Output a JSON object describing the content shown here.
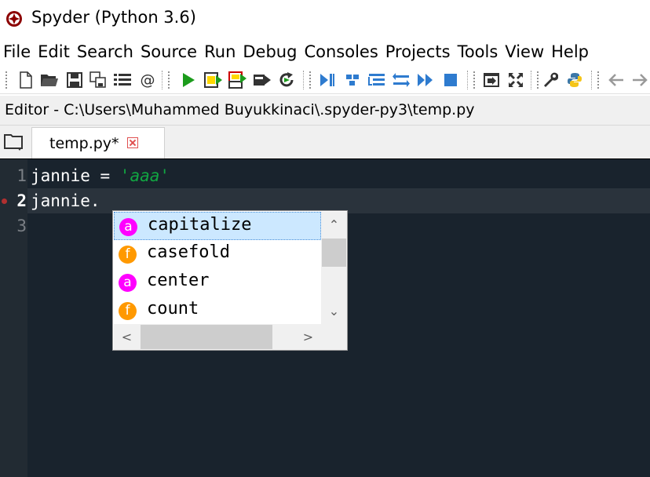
{
  "window": {
    "title": "Spyder (Python 3.6)"
  },
  "menu": [
    "File",
    "Edit",
    "Search",
    "Source",
    "Run",
    "Debug",
    "Consoles",
    "Projects",
    "Tools",
    "View",
    "Help"
  ],
  "toolbar": {
    "file_icons": [
      "new-file-icon",
      "open-file-icon",
      "save-icon",
      "save-all-icon",
      "outline-icon",
      "at-icon"
    ],
    "run_icons": [
      "run-icon",
      "run-cell-icon",
      "run-cell-advance-icon",
      "run-selection-icon",
      "rerun-icon"
    ],
    "debug_icons": [
      "debug-icon",
      "debug-step-icon",
      "debug-step-into-icon",
      "debug-step-return-icon",
      "debug-continue-icon",
      "debug-stop-icon"
    ],
    "window_icons": [
      "maximize-pane-icon",
      "fullscreen-icon"
    ],
    "tool_icons": [
      "preferences-wrench-icon",
      "pythonpath-manager-icon"
    ],
    "nav_icons": [
      "back-arrow-icon",
      "forward-arrow-icon"
    ]
  },
  "pathbar": {
    "text": "Editor - C:\\Users\\Muhammed Buyukkinaci\\.spyder-py3\\temp.py"
  },
  "tabs": [
    {
      "label": "temp.py*",
      "closable": true
    }
  ],
  "editor": {
    "line_numbers": [
      "1",
      "2",
      "3"
    ],
    "current_line": 2,
    "lines": [
      {
        "code": "jannie = ",
        "string": "'aaa'"
      },
      {
        "code": "jannie.",
        "string": ""
      },
      {
        "code": "",
        "string": ""
      }
    ]
  },
  "completion": {
    "items": [
      {
        "badge": "a",
        "label": "capitalize",
        "kind": "attribute",
        "selected": true
      },
      {
        "badge": "f",
        "label": "casefold",
        "kind": "function",
        "selected": false
      },
      {
        "badge": "a",
        "label": "center",
        "kind": "attribute",
        "selected": false
      },
      {
        "badge": "f",
        "label": "count",
        "kind": "function",
        "selected": false
      }
    ],
    "scroll_arrows": {
      "up": "⌃",
      "down": "⌄",
      "left": "<",
      "right": ">"
    }
  },
  "colors": {
    "editor_bg": "#19232d",
    "string": "#11a642",
    "attribute_badge": "#ff00ff",
    "function_badge": "#ff9900",
    "selection": "#cce8ff"
  }
}
